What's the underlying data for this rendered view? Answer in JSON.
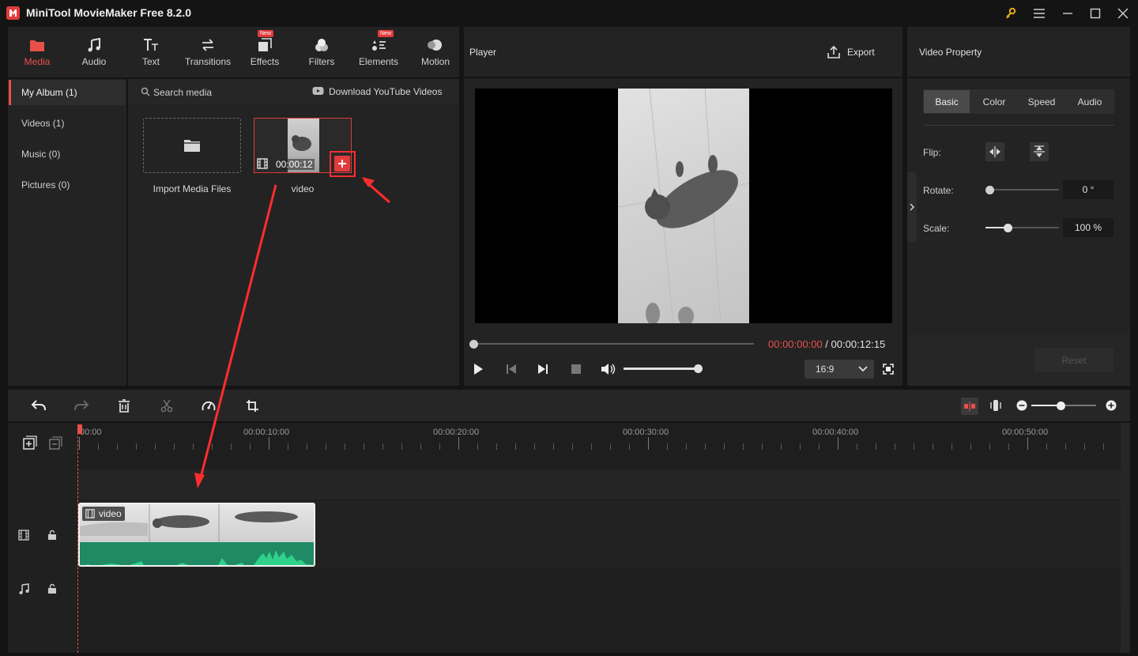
{
  "app": {
    "title": "MiniTool MovieMaker Free 8.2.0"
  },
  "toolbar": {
    "tabs": [
      {
        "label": "Media",
        "icon": "folder-icon",
        "active": true
      },
      {
        "label": "Audio",
        "icon": "music-note-icon"
      },
      {
        "label": "Text",
        "icon": "text-icon"
      },
      {
        "label": "Transitions",
        "icon": "transitions-icon"
      },
      {
        "label": "Effects",
        "icon": "effects-icon",
        "badge": "New"
      },
      {
        "label": "Filters",
        "icon": "filters-icon"
      },
      {
        "label": "Elements",
        "icon": "elements-icon",
        "badge": "New"
      },
      {
        "label": "Motion",
        "icon": "motion-icon"
      }
    ]
  },
  "sidebar": {
    "items": [
      {
        "label": "My Album (1)",
        "active": true
      },
      {
        "label": "Videos (1)"
      },
      {
        "label": "Music (0)"
      },
      {
        "label": "Pictures (0)"
      }
    ]
  },
  "media": {
    "search_label": "Search media",
    "download_label": "Download YouTube Videos",
    "import_label": "Import Media Files",
    "clip": {
      "name": "video",
      "duration": "00:00:12"
    }
  },
  "player": {
    "title": "Player",
    "export_label": "Export",
    "current_time": "00:00:00:00",
    "separator": " / ",
    "total_time": "00:00:12:15",
    "aspect": "16:9",
    "progress": 0,
    "volume": 1.0
  },
  "property": {
    "title": "Video Property",
    "tabs": [
      "Basic",
      "Color",
      "Speed",
      "Audio"
    ],
    "active_tab": "Basic",
    "flip_label": "Flip:",
    "rotate_label": "Rotate:",
    "rotate_value": "0 °",
    "rotate_level": 0.0,
    "scale_label": "Scale:",
    "scale_value": "100 %",
    "scale_level": 0.3,
    "reset_label": "Reset"
  },
  "timeline": {
    "ruler": [
      "00:00",
      "00:00:10:00",
      "00:00:20:00",
      "00:00:30:00",
      "00:00:40:00",
      "00:00:50:00"
    ],
    "clip_label": "video",
    "zoom_level": 0.45
  },
  "colors": {
    "accent": "#e8504a",
    "audio_wave": "#1f8a63",
    "annotation": "#ff2d2d"
  }
}
